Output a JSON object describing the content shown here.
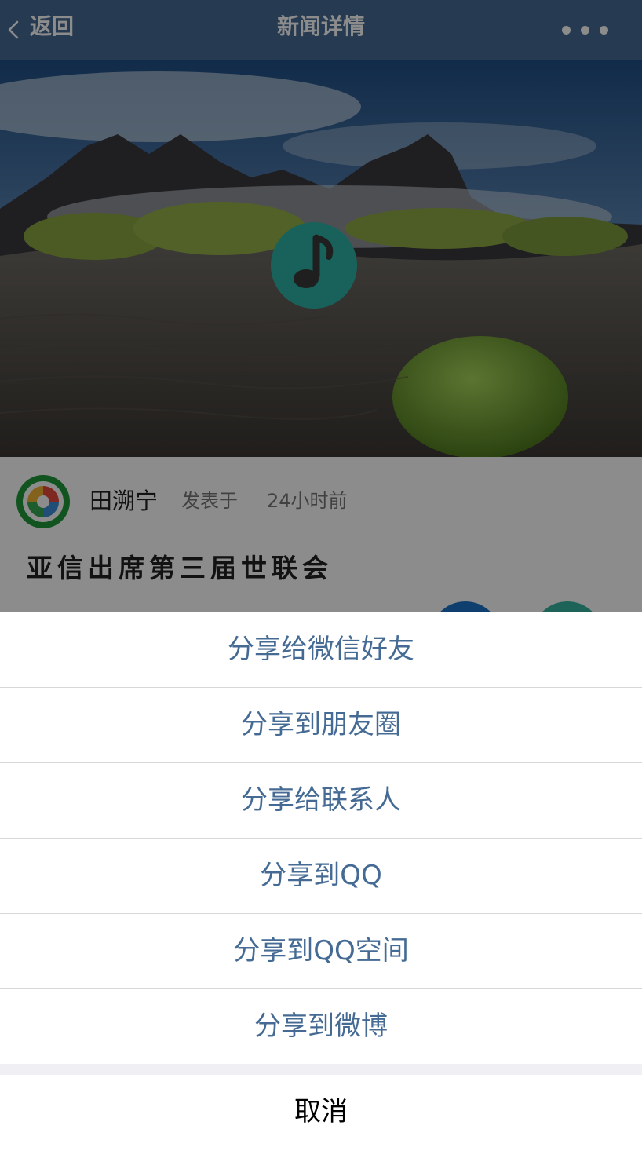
{
  "header": {
    "back_label": "返回",
    "title": "新闻详情",
    "back_icon": "chevron-left-icon",
    "more_icon": "more-dots-icon",
    "background": "#456b94"
  },
  "hero": {
    "overlay_icon": "music-note-icon",
    "icon_color": "#2fb3a6"
  },
  "article": {
    "author": "田溯宁",
    "posted_label": "发表于",
    "time": "24小时前",
    "headline": "亚信出席第三届世联会",
    "avatar_icon": "camera-aperture-icon"
  },
  "share_sheet": {
    "options": [
      {
        "label": "分享给微信好友"
      },
      {
        "label": "分享到朋友圈"
      },
      {
        "label": "分享给联系人"
      },
      {
        "label": "分享到QQ"
      },
      {
        "label": "分享到QQ空间"
      },
      {
        "label": "分享到微博"
      }
    ],
    "cancel_label": "取消",
    "option_color": "#456b94"
  }
}
